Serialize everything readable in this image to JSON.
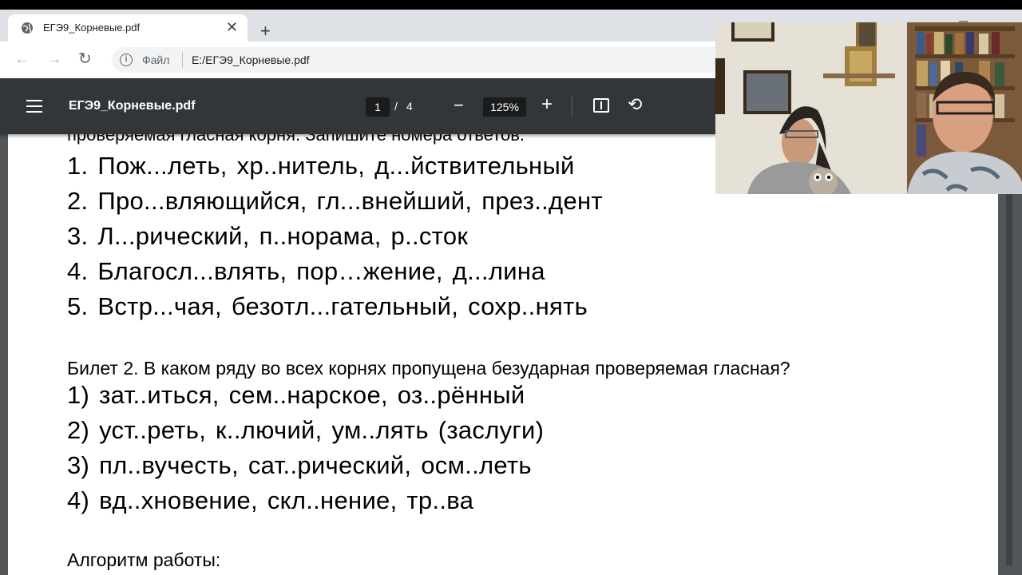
{
  "browser": {
    "tab_title": "ЕГЭ9_Корневые.pdf",
    "tab_close": "✕",
    "new_tab": "+",
    "back": "←",
    "forward": "→",
    "reload": "↻",
    "info": "i",
    "scheme": "Файл",
    "url": "E:/ЕГЭ9_Корневые.pdf",
    "window_controls": [
      "—",
      "❐",
      "✕"
    ]
  },
  "pdf_toolbar": {
    "title": "ЕГЭ9_Корневые.pdf",
    "current_page": "1",
    "page_separator": "/",
    "total_pages": "4",
    "zoom_out": "−",
    "zoom": "125%",
    "zoom_in": "+",
    "rotate": "⟲"
  },
  "document": {
    "cut_line": "проверяемая гласная корня. Запишите номера ответов.",
    "ticket1_items": [
      "1. Пож...леть, хр..нитель, д...йствительный",
      "2. Про...вляющийся, гл...внейший, през..дент",
      "3. Л...рический, п..норама, р..сток",
      "4. Благосл...влять, пор…жение, д...лина",
      "5. Встр...чая, безотл...гательный, сохр..нять"
    ],
    "ticket2_question": "Билет 2. В каком ряду во всех корнях пропущена безударная проверяемая гласная?",
    "ticket2_items": [
      "1) зат..иться, сем..нарское, оз..рённый",
      "2) уст..реть, к..лючий, ум..лять (заслуги)",
      "3) пл..вучесть, сат..рический, осм..леть",
      "4) вд..хновение, скл..нение, тр..ва"
    ],
    "algorithm_heading": "Алгоритм работы:"
  },
  "icons": [
    "globe-icon",
    "close-icon",
    "plus-icon",
    "back-icon",
    "forward-icon",
    "reload-icon",
    "info-icon",
    "menu-icon",
    "zoom-out-icon",
    "zoom-in-icon",
    "fit-page-icon",
    "rotate-icon"
  ]
}
